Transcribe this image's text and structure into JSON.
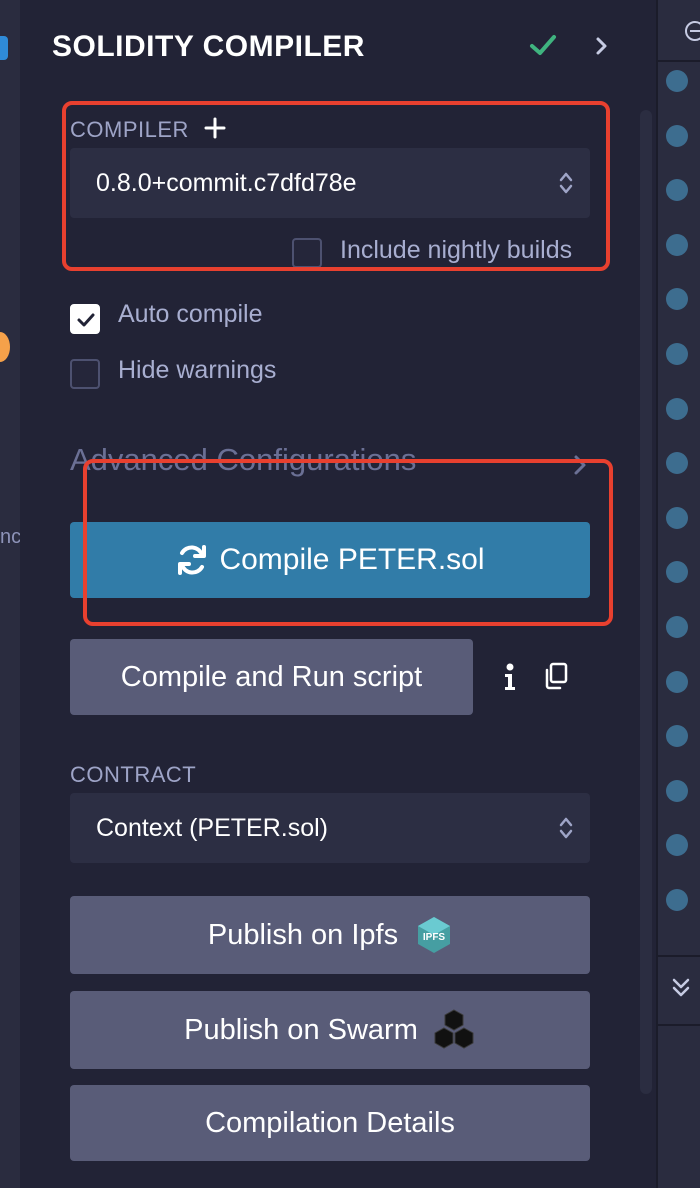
{
  "header": {
    "title": "SOLIDITY COMPILER"
  },
  "left_strip": {
    "text_fragment": "nc"
  },
  "compiler": {
    "label": "COMPILER",
    "selected_version": "0.8.0+commit.c7dfd78e",
    "nightly_label": "Include nightly builds",
    "nightly_checked": false
  },
  "options": {
    "auto_compile_label": "Auto compile",
    "auto_compile_checked": true,
    "hide_warnings_label": "Hide warnings",
    "hide_warnings_checked": false
  },
  "advanced": {
    "label": "Advanced Configurations"
  },
  "buttons": {
    "compile": "Compile PETER.sol",
    "compile_run": "Compile and Run script",
    "publish_ipfs": "Publish on Ipfs",
    "publish_swarm": "Publish on Swarm",
    "compilation_details": "Compilation Details"
  },
  "contract": {
    "label": "CONTRACT",
    "selected": "Context (PETER.sol)"
  },
  "icons": {
    "ipfs_text": "IPFS"
  },
  "colors": {
    "accent": "#317ca8",
    "success": "#3fb37f",
    "highlight": "#e8402f"
  }
}
